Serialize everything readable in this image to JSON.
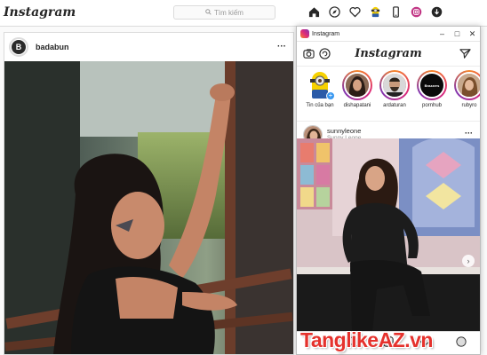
{
  "web": {
    "logo": "Instagram",
    "search_placeholder": "Tìm kiếm",
    "post": {
      "username": "badabun",
      "avatar_letter": "B"
    }
  },
  "window": {
    "title": "Instagram",
    "app_logo": "Instagram",
    "stories": [
      {
        "label": "Tin của bạn"
      },
      {
        "label": "dishapatani"
      },
      {
        "label": "ardaturan"
      },
      {
        "label": "pornhub"
      },
      {
        "label": "rubyro"
      }
    ],
    "post": {
      "username": "sunnyleone",
      "subtitle": "Sunny Leone"
    },
    "story_logo_text": "Brazzers"
  },
  "watermark": "TanglikeAZ.vn",
  "colors": {
    "accent_red": "#e5322d",
    "border": "#dbdbdb",
    "text": "#262626"
  }
}
